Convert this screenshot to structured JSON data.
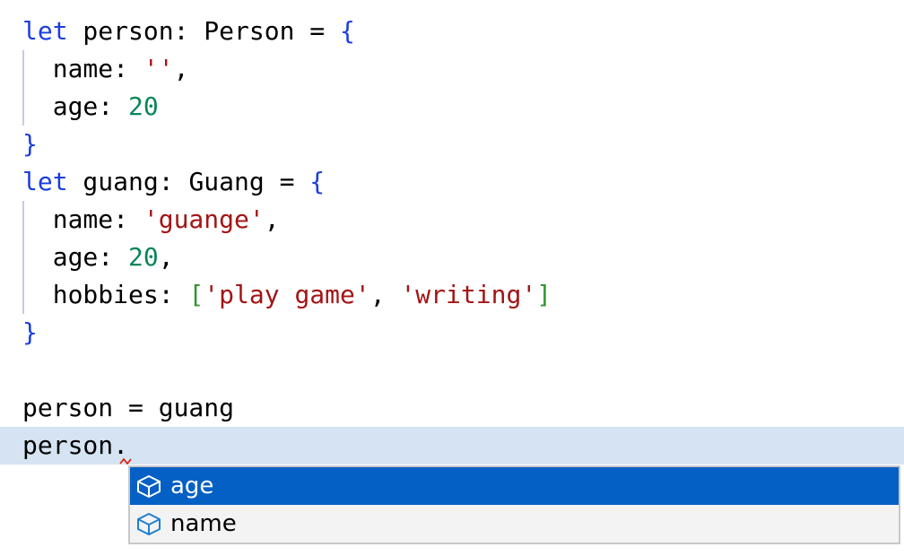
{
  "colors": {
    "keyword": "#1a3ee0",
    "string": "#a31515",
    "number": "#098658",
    "brace": "#1a3ee0",
    "bracket": "#319331",
    "plain": "#000000",
    "selection": "#0460c4",
    "current_line": "#d6e3f2"
  },
  "code": [
    [
      {
        "t": "let",
        "c": "keyword"
      },
      {
        "t": " person: Person = ",
        "c": "plain"
      },
      {
        "t": "{",
        "c": "brace"
      }
    ],
    [
      {
        "t": "  name: ",
        "c": "plain"
      },
      {
        "t": "''",
        "c": "string"
      },
      {
        "t": ",",
        "c": "plain"
      }
    ],
    [
      {
        "t": "  age: ",
        "c": "plain"
      },
      {
        "t": "20",
        "c": "number"
      }
    ],
    [
      {
        "t": "}",
        "c": "brace"
      }
    ],
    [
      {
        "t": "let",
        "c": "keyword"
      },
      {
        "t": " guang: Guang = ",
        "c": "plain"
      },
      {
        "t": "{",
        "c": "brace"
      }
    ],
    [
      {
        "t": "  name: ",
        "c": "plain"
      },
      {
        "t": "'guange'",
        "c": "string"
      },
      {
        "t": ",",
        "c": "plain"
      }
    ],
    [
      {
        "t": "  age: ",
        "c": "plain"
      },
      {
        "t": "20",
        "c": "number"
      },
      {
        "t": ",",
        "c": "plain"
      }
    ],
    [
      {
        "t": "  hobbies: ",
        "c": "plain"
      },
      {
        "t": "[",
        "c": "bracket"
      },
      {
        "t": "'play game'",
        "c": "string"
      },
      {
        "t": ", ",
        "c": "plain"
      },
      {
        "t": "'writing'",
        "c": "string"
      },
      {
        "t": "]",
        "c": "bracket"
      }
    ],
    [
      {
        "t": "}",
        "c": "brace"
      }
    ],
    [],
    [
      {
        "t": "person = guang",
        "c": "plain"
      }
    ],
    [
      {
        "t": "person.",
        "c": "plain"
      }
    ]
  ],
  "suggestions": [
    {
      "label": "age",
      "icon": "property-cube-icon",
      "selected": true
    },
    {
      "label": "name",
      "icon": "property-cube-icon",
      "selected": false
    }
  ]
}
